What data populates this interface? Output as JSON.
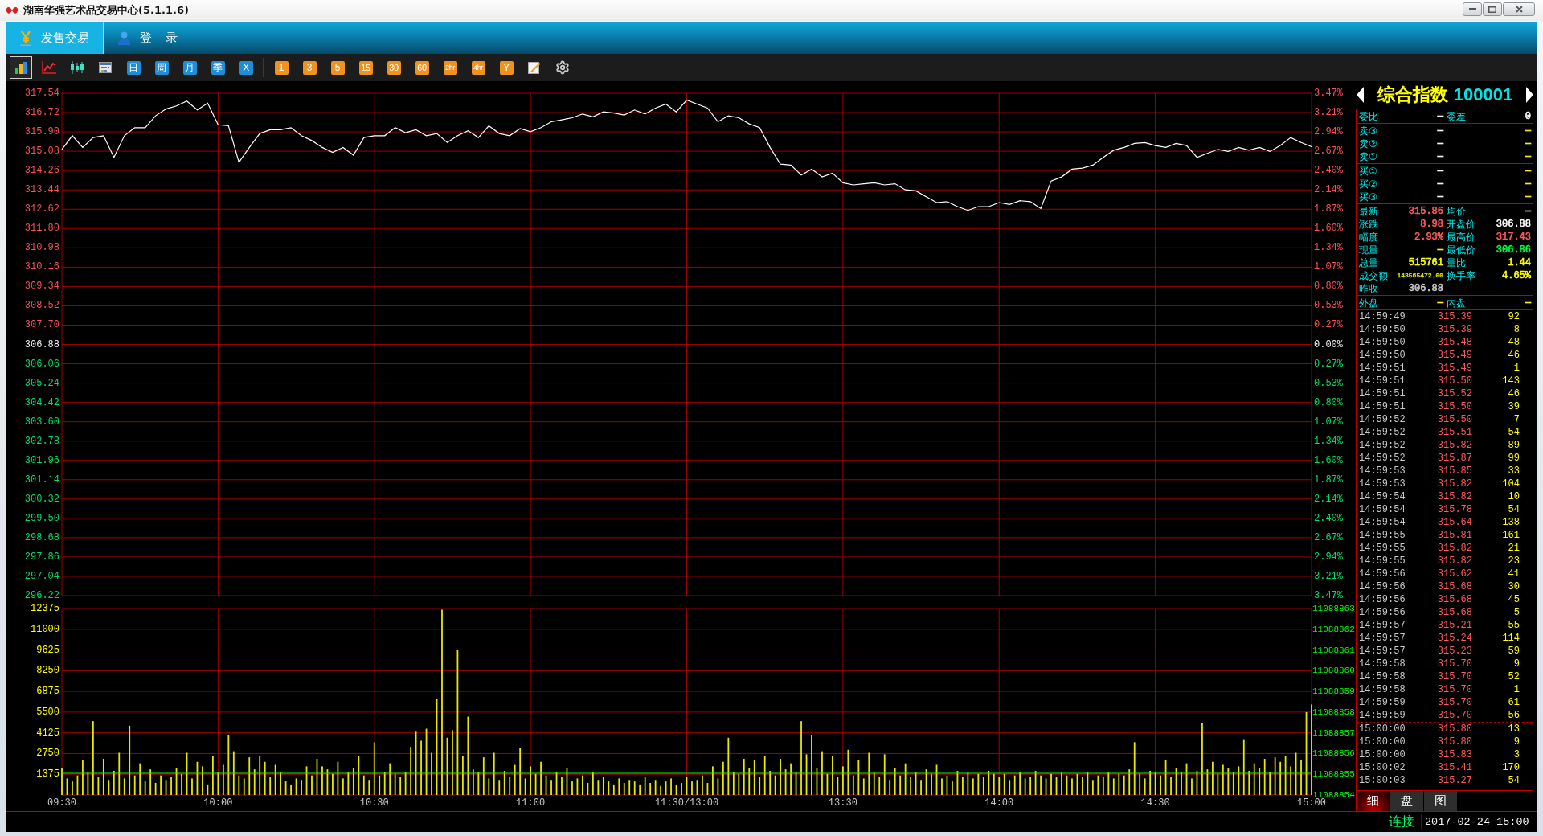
{
  "window": {
    "title": "湖南华强艺术品交易中心(5.1.1.6)"
  },
  "nav_tabs": [
    {
      "label": "发售交易",
      "selected": true
    },
    {
      "label": "登 录",
      "selected": false
    }
  ],
  "toolbar": {
    "chart_buttons": [
      {
        "selected": true
      },
      {
        "selected": false
      },
      {
        "selected": false
      },
      {
        "selected": false
      }
    ],
    "period_buttons": [
      {
        "label": "日"
      },
      {
        "label": "周"
      },
      {
        "label": "月"
      },
      {
        "label": "季"
      },
      {
        "label": "X"
      }
    ],
    "minute_buttons": [
      {
        "label": "1"
      },
      {
        "label": "3"
      },
      {
        "label": "5"
      },
      {
        "label": "15"
      },
      {
        "label": "30"
      },
      {
        "label": "60"
      },
      {
        "label": "2hr"
      },
      {
        "label": "4hr"
      },
      {
        "label": "Y"
      }
    ]
  },
  "price_panel": {
    "chart_data": {
      "type": "line",
      "grid": true,
      "ylim": [
        296.22,
        317.54
      ],
      "yticks": [
        {
          "value": 317.54,
          "label": "317.54"
        },
        {
          "value": 316.72,
          "label": "316.72"
        },
        {
          "value": 315.9,
          "label": "315.90"
        },
        {
          "value": 315.08,
          "label": "315.08"
        },
        {
          "value": 314.26,
          "label": "314.26"
        },
        {
          "value": 313.44,
          "label": "313.44"
        },
        {
          "value": 312.62,
          "label": "312.62"
        },
        {
          "value": 311.8,
          "label": "311.80"
        },
        {
          "value": 310.98,
          "label": "310.98"
        },
        {
          "value": 310.16,
          "label": "310.16"
        },
        {
          "value": 309.34,
          "label": "309.34"
        },
        {
          "value": 308.52,
          "label": "308.52"
        },
        {
          "value": 307.7,
          "label": "307.70"
        },
        {
          "value": 306.88,
          "label": "306.88"
        },
        {
          "value": 306.06,
          "label": "306.06"
        },
        {
          "value": 305.24,
          "label": "305.24"
        },
        {
          "value": 304.42,
          "label": "304.42"
        },
        {
          "value": 303.6,
          "label": "303.60"
        },
        {
          "value": 302.78,
          "label": "302.78"
        },
        {
          "value": 301.96,
          "label": "301.96"
        },
        {
          "value": 301.14,
          "label": "301.14"
        },
        {
          "value": 300.32,
          "label": "300.32"
        },
        {
          "value": 299.5,
          "label": "299.50"
        },
        {
          "value": 298.68,
          "label": "298.68"
        },
        {
          "value": 297.86,
          "label": "297.86"
        },
        {
          "value": 297.04,
          "label": "297.04"
        },
        {
          "value": 296.22,
          "label": "296.22"
        }
      ],
      "series": [
        {
          "color": "#ffffff",
          "values": [
            315.16,
            315.74,
            315.24,
            315.66,
            315.74,
            314.82,
            315.74,
            316.08,
            316.08,
            316.58,
            316.87,
            317.0,
            317.21,
            316.83,
            317.12,
            316.2,
            316.16,
            314.61,
            315.24,
            315.83,
            315.99,
            315.99,
            316.08,
            315.74,
            315.53,
            315.24,
            315.03,
            315.24,
            314.91,
            315.66,
            315.74,
            315.74,
            316.08,
            315.87,
            315.99,
            315.74,
            315.83,
            315.45,
            315.74,
            315.95,
            315.66,
            316.16,
            315.83,
            315.74,
            316.04,
            315.91,
            316.08,
            316.33,
            316.41,
            316.5,
            316.66,
            316.54,
            316.75,
            316.7,
            316.62,
            316.83,
            316.66,
            316.91,
            317.08,
            316.75,
            317.25,
            317.08,
            316.91,
            316.33,
            316.58,
            316.5,
            316.24,
            316.08,
            315.24,
            314.53,
            314.49,
            314.07,
            314.32,
            313.99,
            314.15,
            313.74,
            313.65,
            313.7,
            313.74,
            313.65,
            313.7,
            313.44,
            313.4,
            313.15,
            312.9,
            312.94,
            312.73,
            312.57,
            312.73,
            312.73,
            312.9,
            312.82,
            312.98,
            312.94,
            312.65,
            313.82,
            313.99,
            314.32,
            314.36,
            314.49,
            314.82,
            315.12,
            315.24,
            315.41,
            315.45,
            315.32,
            315.24,
            315.41,
            315.32,
            314.82,
            314.99,
            315.16,
            315.07,
            315.24,
            315.12,
            315.24,
            315.07,
            315.32,
            315.66,
            315.45,
            315.27
          ]
        }
      ]
    },
    "pct_axis": [
      {
        "label": "3.47%",
        "color": "#ff5050"
      },
      {
        "label": "3.21%",
        "color": "#ff5050"
      },
      {
        "label": "2.94%",
        "color": "#ff5050"
      },
      {
        "label": "2.67%",
        "color": "#ff5050"
      },
      {
        "label": "2.40%",
        "color": "#ff5050"
      },
      {
        "label": "2.14%",
        "color": "#ff5050"
      },
      {
        "label": "1.87%",
        "color": "#ff5050"
      },
      {
        "label": "1.60%",
        "color": "#ff5050"
      },
      {
        "label": "1.34%",
        "color": "#ff5050"
      },
      {
        "label": "1.07%",
        "color": "#ff5050"
      },
      {
        "label": "0.80%",
        "color": "#ff5050"
      },
      {
        "label": "0.53%",
        "color": "#ff5050"
      },
      {
        "label": "0.27%",
        "color": "#ff5050"
      },
      {
        "label": "0.00%",
        "color": "#f0f0f0"
      },
      {
        "label": "0.27%",
        "color": "#00e060"
      },
      {
        "label": "0.53%",
        "color": "#00e060"
      },
      {
        "label": "0.80%",
        "color": "#00e060"
      },
      {
        "label": "1.07%",
        "color": "#00e060"
      },
      {
        "label": "1.34%",
        "color": "#00e060"
      },
      {
        "label": "1.60%",
        "color": "#00e060"
      },
      {
        "label": "1.87%",
        "color": "#00e060"
      },
      {
        "label": "2.14%",
        "color": "#00e060"
      },
      {
        "label": "2.40%",
        "color": "#00e060"
      },
      {
        "label": "2.67%",
        "color": "#00e060"
      },
      {
        "label": "2.94%",
        "color": "#00e060"
      },
      {
        "label": "3.21%",
        "color": "#00e060"
      },
      {
        "label": "3.47%",
        "color": "#00e060"
      }
    ]
  },
  "volume_panel": {
    "chart_data": {
      "type": "bar",
      "grid": true,
      "ylim": [
        0,
        12375
      ],
      "yticks": [
        {
          "value": 12375,
          "label": "12375"
        },
        {
          "value": 11000,
          "label": "11000"
        },
        {
          "value": 9625,
          "label": "9625"
        },
        {
          "value": 8250,
          "label": "8250"
        },
        {
          "value": 6875,
          "label": "6875"
        },
        {
          "value": 5500,
          "label": "5500"
        },
        {
          "value": 4125,
          "label": "4125"
        },
        {
          "value": 2750,
          "label": "2750"
        },
        {
          "value": 1375,
          "label": "1375"
        }
      ],
      "series": [
        {
          "color": "#e8e800",
          "values": [
            1800,
            1100,
            900,
            1300,
            2300,
            1500,
            4900,
            1200,
            2400,
            1000,
            1600,
            2800,
            1100,
            4600,
            1300,
            2100,
            900,
            1700,
            800,
            1300,
            1000,
            1200,
            1800,
            1400,
            2800,
            1100,
            2200,
            1900,
            700,
            2600,
            1500,
            2000,
            4000,
            2900,
            1300,
            1100,
            2500,
            1700,
            2600,
            2200,
            1200,
            2000,
            1500,
            900,
            700,
            1100,
            1000,
            1900,
            1300,
            2400,
            1900,
            1700,
            1400,
            2200,
            1100,
            1500,
            1800,
            2600,
            1300,
            1000,
            3500,
            1300,
            1500,
            2100,
            1400,
            1200,
            1500,
            3200,
            4200,
            3600,
            4400,
            2800,
            6400,
            12300,
            3800,
            4300,
            9600,
            2600,
            5200,
            1700,
            1500,
            2500,
            1100,
            2800,
            1000,
            1600,
            1200,
            2000,
            3100,
            1100,
            1900,
            1400,
            2200,
            1300,
            1000,
            1500,
            1200,
            1800,
            900,
            1100,
            1300,
            800,
            1500,
            1000,
            1200,
            900,
            700,
            1100,
            800,
            1000,
            900,
            700,
            1200,
            800,
            1000,
            600,
            900,
            1100,
            700,
            800,
            1200,
            900,
            1000,
            1300,
            800,
            1900,
            1100,
            2200,
            3800,
            1500,
            1400,
            2400,
            1800,
            2300,
            1200,
            2600,
            1600,
            1300,
            2400,
            1700,
            2100,
            1500,
            4900,
            2700,
            4000,
            1800,
            2900,
            1400,
            2600,
            1200,
            1900,
            3000,
            1300,
            2300,
            1100,
            2800,
            1500,
            1200,
            2700,
            1000,
            1800,
            1300,
            2100,
            1200,
            1500,
            1000,
            1700,
            1400,
            2000,
            1100,
            1300,
            900,
            1600,
            1200,
            1500,
            1100,
            1400,
            1200,
            1600,
            1400,
            1200,
            1400,
            1000,
            1300,
            1500,
            1100,
            1200,
            1600,
            1300,
            1100,
            1400,
            1200,
            1500,
            1300,
            1100,
            1400,
            1200,
            1500,
            1000,
            1300,
            1200,
            1500,
            1100,
            1400,
            1300,
            1700,
            3500,
            1400,
            1100,
            1600,
            1500,
            1300,
            2300,
            1200,
            1800,
            1500,
            2100,
            1100,
            1600,
            4800,
            1700,
            2200,
            1400,
            2000,
            1800,
            1500,
            1900,
            3700,
            1600,
            2100,
            1800,
            2400,
            1500,
            2500,
            2200,
            2600,
            1900,
            2800,
            2300,
            5500,
            6000
          ]
        }
      ],
      "ref_lines": [
        {
          "axis": "y",
          "value": 1440,
          "color": "#00ff00"
        }
      ]
    },
    "right_axis": [
      "11088863",
      "11088862",
      "11088861",
      "11088860",
      "11088859",
      "11088858",
      "11088857",
      "11088856",
      "11088855",
      "11088854"
    ],
    "time_axis": [
      "09:30",
      "10:00",
      "10:30",
      "11:00",
      "11:30/13:00",
      "13:30",
      "14:00",
      "14:30",
      "15:00"
    ]
  },
  "quote_panel": {
    "name": "综合指数",
    "code": "100001",
    "sections": [
      {
        "rows": [
          [
            {
              "label": "委比",
              "value": "—",
              "color": "#ffffff"
            },
            {
              "label": "委差",
              "value": "0",
              "color": "#ffffff"
            }
          ]
        ]
      },
      {
        "rows": [
          [
            {
              "label": "卖③",
              "value": "—",
              "color": "#ffffff"
            },
            {
              "value": "—",
              "color": "#ffff00"
            }
          ],
          [
            {
              "label": "卖②",
              "value": "—",
              "color": "#ffffff"
            },
            {
              "value": "—",
              "color": "#ffff00"
            }
          ],
          [
            {
              "label": "卖①",
              "value": "—",
              "color": "#ffffff"
            },
            {
              "value": "—",
              "color": "#ffff00"
            }
          ]
        ]
      },
      {
        "rows": [
          [
            {
              "label": "买①",
              "value": "—",
              "color": "#ffffff"
            },
            {
              "value": "—",
              "color": "#ffff00"
            }
          ],
          [
            {
              "label": "买②",
              "value": "—",
              "color": "#ffffff"
            },
            {
              "value": "—",
              "color": "#ffff00"
            }
          ],
          [
            {
              "label": "买③",
              "value": "—",
              "color": "#ffffff"
            },
            {
              "value": "—",
              "color": "#ffff00"
            }
          ]
        ]
      },
      {
        "rows": [
          [
            {
              "label": "最新",
              "value": "315.86",
              "color": "#ff5a5a"
            },
            {
              "label": "均价",
              "value": "—",
              "color": "#ffffff"
            }
          ],
          [
            {
              "label": "涨跌",
              "value": "8.98",
              "color": "#ff5a5a"
            },
            {
              "label": "开盘价",
              "value": "306.88",
              "color": "#ffffff"
            }
          ],
          [
            {
              "label": "幅度",
              "value": "2.93%",
              "color": "#ff5a5a"
            },
            {
              "label": "最高价",
              "value": "317.43",
              "color": "#ff5a5a"
            }
          ],
          [
            {
              "label": "现量",
              "value": "—",
              "color": "#ffff00"
            },
            {
              "label": "最低价",
              "value": "306.86",
              "color": "#00ff40"
            }
          ],
          [
            {
              "label": "总量",
              "value": "515761",
              "color": "#ffff00"
            },
            {
              "label": "量比",
              "value": "1.44",
              "color": "#ffff00"
            }
          ],
          [
            {
              "label": "成交额",
              "value": "143565472.00",
              "color": "#d8d800"
            },
            {
              "label": "换手率",
              "value": "4.65%",
              "color": "#ffff00"
            }
          ],
          [
            {
              "label": "昨收",
              "value": "306.88",
              "color": "#c8c8c8"
            }
          ]
        ]
      },
      {
        "rows": [
          [
            {
              "label": "外盘",
              "value": "—",
              "color": "#ffff00"
            },
            {
              "label": "内盘",
              "value": "—",
              "color": "#ffff00"
            }
          ]
        ]
      }
    ],
    "trades": [
      {
        "rows": [
          {
            "time": "14:59:49",
            "price": "315.39",
            "volume": "92"
          },
          {
            "time": "14:59:50",
            "price": "315.39",
            "volume": "8"
          },
          {
            "time": "14:59:50",
            "price": "315.48",
            "volume": "48"
          },
          {
            "time": "14:59:50",
            "price": "315.49",
            "volume": "46"
          },
          {
            "time": "14:59:51",
            "price": "315.49",
            "volume": "1"
          },
          {
            "time": "14:59:51",
            "price": "315.50",
            "volume": "143"
          },
          {
            "time": "14:59:51",
            "price": "315.52",
            "volume": "46"
          },
          {
            "time": "14:59:51",
            "price": "315.50",
            "volume": "39"
          },
          {
            "time": "14:59:52",
            "price": "315.50",
            "volume": "7"
          },
          {
            "time": "14:59:52",
            "price": "315.51",
            "volume": "54"
          },
          {
            "time": "14:59:52",
            "price": "315.82",
            "volume": "89"
          },
          {
            "time": "14:59:52",
            "price": "315.87",
            "volume": "99"
          },
          {
            "time": "14:59:53",
            "price": "315.85",
            "volume": "33"
          },
          {
            "time": "14:59:53",
            "price": "315.82",
            "volume": "104"
          },
          {
            "time": "14:59:54",
            "price": "315.82",
            "volume": "10"
          },
          {
            "time": "14:59:54",
            "price": "315.78",
            "volume": "54"
          },
          {
            "time": "14:59:54",
            "price": "315.64",
            "volume": "138"
          },
          {
            "time": "14:59:55",
            "price": "315.81",
            "volume": "161"
          },
          {
            "time": "14:59:55",
            "price": "315.82",
            "volume": "21"
          },
          {
            "time": "14:59:55",
            "price": "315.82",
            "volume": "23"
          },
          {
            "time": "14:59:56",
            "price": "315.62",
            "volume": "41"
          },
          {
            "time": "14:59:56",
            "price": "315.68",
            "volume": "30"
          },
          {
            "time": "14:59:56",
            "price": "315.68",
            "volume": "45"
          },
          {
            "time": "14:59:56",
            "price": "315.68",
            "volume": "5"
          },
          {
            "time": "14:59:57",
            "price": "315.21",
            "volume": "55"
          },
          {
            "time": "14:59:57",
            "price": "315.24",
            "volume": "114"
          },
          {
            "time": "14:59:57",
            "price": "315.23",
            "volume": "59"
          },
          {
            "time": "14:59:58",
            "price": "315.70",
            "volume": "9"
          },
          {
            "time": "14:59:58",
            "price": "315.70",
            "volume": "52"
          },
          {
            "time": "14:59:58",
            "price": "315.70",
            "volume": "1"
          },
          {
            "time": "14:59:59",
            "price": "315.70",
            "volume": "61"
          },
          {
            "time": "14:59:59",
            "price": "315.70",
            "volume": "56"
          }
        ]
      },
      {
        "rows": [
          {
            "time": "15:00:00",
            "price": "315.80",
            "volume": "13"
          },
          {
            "time": "15:00:00",
            "price": "315.80",
            "volume": "9"
          },
          {
            "time": "15:00:00",
            "price": "315.83",
            "volume": "3"
          },
          {
            "time": "15:00:02",
            "price": "315.41",
            "volume": "170"
          },
          {
            "time": "15:00:03",
            "price": "315.27",
            "volume": "54"
          }
        ]
      }
    ],
    "tabs": [
      {
        "label": "细",
        "selected": true
      },
      {
        "label": "盘",
        "selected": false
      },
      {
        "label": "图",
        "selected": false
      }
    ]
  },
  "status_bar": {
    "connection": "连接",
    "datetime": "2017-02-24 15:00"
  }
}
